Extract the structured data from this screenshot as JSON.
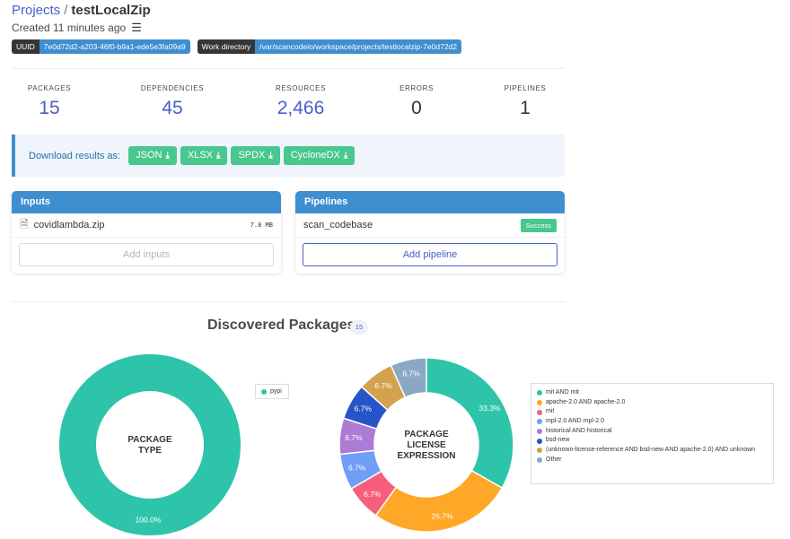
{
  "breadcrumb": {
    "parent": "Projects",
    "separator": "/",
    "current": "testLocalZip"
  },
  "created": {
    "text": "Created 11 minutes ago",
    "icon": "sliders-icon"
  },
  "tags": {
    "uuid_label": "UUID",
    "uuid_value": "7e0d72d2-a203-46f0-b9a1-ede5e3fa09a9",
    "workdir_label": "Work directory",
    "workdir_value": "/var/scancodeio/workspace/projects/testlocalzip-7e0d72d2"
  },
  "stats": [
    {
      "label": "PACKAGES",
      "value": "15",
      "link": true
    },
    {
      "label": "DEPENDENCIES",
      "value": "45",
      "link": true
    },
    {
      "label": "RESOURCES",
      "value": "2,466",
      "link": true
    },
    {
      "label": "ERRORS",
      "value": "0",
      "link": false
    },
    {
      "label": "PIPELINES",
      "value": "1",
      "link": false
    }
  ],
  "download": {
    "label": "Download results as:",
    "buttons": [
      "JSON",
      "XLSX",
      "SPDX",
      "CycloneDX"
    ],
    "icon": "download-icon"
  },
  "inputs": {
    "title": "Inputs",
    "file_name": "covidlambda.zip",
    "file_size": "7.8 MB",
    "add_label": "Add inputs"
  },
  "pipelines": {
    "title": "Pipelines",
    "name": "scan_codebase",
    "status": "Success",
    "add_label": "Add pipeline"
  },
  "discovered": {
    "title": "Discovered Packages",
    "count": "15"
  },
  "colors": {
    "teal": "#2ec4a9",
    "orange": "#ffa726",
    "pink": "#f65f7c",
    "light_blue": "#6e9ef5",
    "purple": "#ab7bd6",
    "dark_blue": "#2854c9",
    "tan": "#d2a24c",
    "gray_blue": "#8aa8c4",
    "accent": "#3e8ed0",
    "success": "#48c78e"
  },
  "chart_data": [
    {
      "type": "pie",
      "center_label": [
        "PACKAGE",
        "TYPE"
      ],
      "slices": [
        {
          "label": "pypi",
          "value": 100.0,
          "display": "100.0%",
          "color": "#2ec4a9"
        }
      ],
      "legend": "right"
    },
    {
      "type": "pie",
      "center_label": [
        "PACKAGE",
        "LICENSE",
        "EXPRESSION"
      ],
      "slices": [
        {
          "label": "mit AND mit",
          "value": 33.3,
          "display": "33.3%",
          "color": "#2ec4a9"
        },
        {
          "label": "apache-2.0 AND apache-2.0",
          "value": 26.7,
          "display": "26.7%",
          "color": "#ffa726"
        },
        {
          "label": "mit",
          "value": 6.7,
          "display": "6.7%",
          "color": "#f65f7c"
        },
        {
          "label": "mpl-2.0 AND mpl-2.0",
          "value": 6.7,
          "display": "6.7%",
          "color": "#6e9ef5"
        },
        {
          "label": "historical AND historical",
          "value": 6.7,
          "display": "6.7%",
          "color": "#ab7bd6"
        },
        {
          "label": "bsd-new",
          "value": 6.7,
          "display": "6.7%",
          "color": "#2854c9"
        },
        {
          "label": "(unknown-license-reference AND bsd-new AND apache-2.0) AND unknown",
          "value": 6.7,
          "display": "6.7%",
          "color": "#d2a24c"
        },
        {
          "label": "Other",
          "value": 6.7,
          "display": "6.7%",
          "color": "#8aa8c4"
        }
      ],
      "legend": "right"
    }
  ]
}
